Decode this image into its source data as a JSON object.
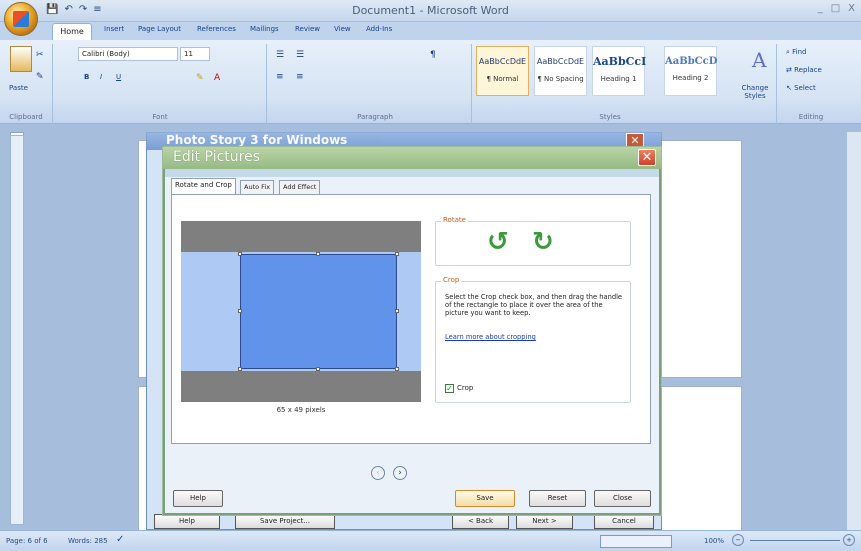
{
  "window": {
    "title": "Document1 - Microsoft Word",
    "controls": [
      "_",
      "□",
      "X"
    ]
  },
  "quick_access": [
    "💾",
    "↶",
    "↷",
    "≡"
  ],
  "ribbon_tabs": [
    "Home",
    "Insert",
    "Page Layout",
    "References",
    "Mailings",
    "Review",
    "View",
    "Add-Ins"
  ],
  "ribbon": {
    "clipboard": {
      "paste": "Paste",
      "label": "Clipboard"
    },
    "font": {
      "name": "Calibri (Body)",
      "size": "11",
      "label": "Font",
      "bold": "B",
      "italic": "I",
      "underline": "U"
    },
    "paragraph": {
      "label": "Paragraph"
    },
    "styles": {
      "label": "Styles",
      "items": [
        {
          "preview": "AaBbCcDdE",
          "name": "¶ Normal"
        },
        {
          "preview": "AaBbCcDdE",
          "name": "¶ No Spacing"
        },
        {
          "preview": "AaBbCcI",
          "name": "Heading 1"
        },
        {
          "preview": "AaBbCcD",
          "name": "Heading 2"
        }
      ],
      "change": "Change Styles"
    },
    "editing": {
      "find": "Find",
      "replace": "Replace",
      "select": "Select",
      "label": "Editing"
    }
  },
  "photo_story": {
    "title": "Photo Story 3 for Windows",
    "buttons": {
      "help": "Help",
      "save_project": "Save Project...",
      "back": "< Back",
      "next": "Next >",
      "cancel": "Cancel"
    }
  },
  "dialog": {
    "title": "Edit Pictures",
    "tabs": [
      "Rotate and Crop",
      "Auto Fix",
      "Add Effect"
    ],
    "rotate_legend": "Rotate",
    "crop_legend": "Crop",
    "crop_description": "Select the Crop check box, and then drag the handle of the rectangle to place it over the area of the picture you want to keep.",
    "crop_link": "Learn more about cropping",
    "crop_checkbox": "Crop",
    "crop_checked": true,
    "pixels": "65 x 49 pixels",
    "buttons": {
      "help": "Help",
      "save": "Save",
      "reset": "Reset",
      "close": "Close"
    }
  },
  "status": {
    "page": "Page: 6 of 6",
    "words": "Words: 285",
    "zoom": "100%"
  }
}
